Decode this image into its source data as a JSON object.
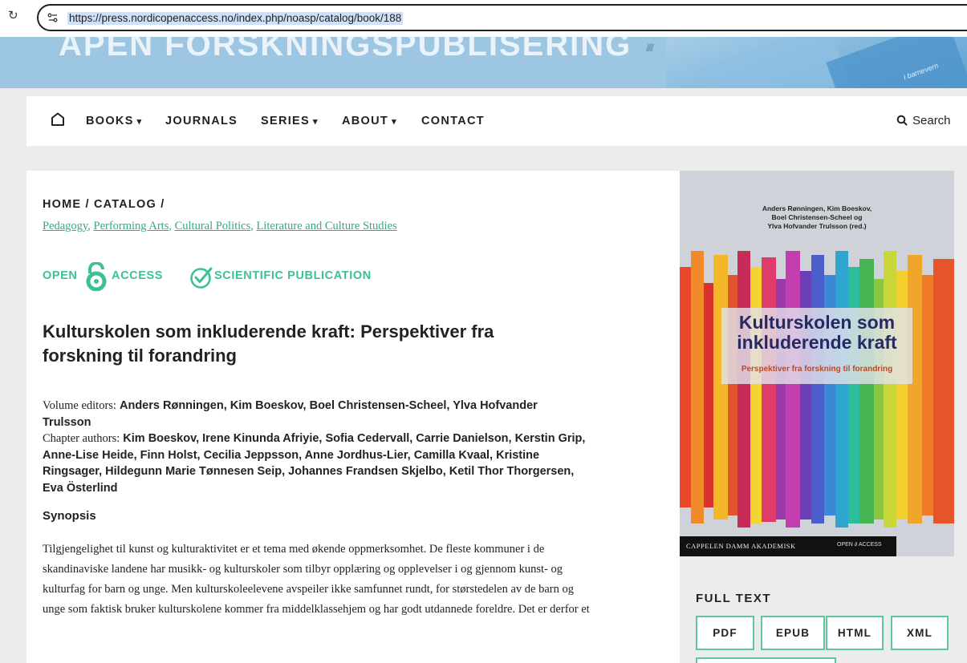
{
  "browser": {
    "url": "https://press.nordicopenaccess.no/index.php/noasp/catalog/book/188"
  },
  "banner": {
    "title": "ÅPEN FORSKNINGSPUBLISERING",
    "small_text": "i barnevern"
  },
  "nav": {
    "items": [
      {
        "label": "BOOKS",
        "caret": true
      },
      {
        "label": "JOURNALS",
        "caret": false
      },
      {
        "label": "SERIES",
        "caret": true
      },
      {
        "label": "ABOUT",
        "caret": true
      },
      {
        "label": "CONTACT",
        "caret": false
      }
    ],
    "search_label": "Search"
  },
  "breadcrumb": {
    "home": "HOME",
    "catalog": "CATALOG",
    "separator": "/"
  },
  "categories": [
    "Pedagogy",
    "Performing Arts",
    "Cultural Politics",
    "Literature and Culture Studies"
  ],
  "badges": {
    "open_left": "OPEN",
    "open_right": "ACCESS",
    "scientific": "SCIENTIFIC PUBLICATION",
    "color": "#3cc290"
  },
  "book": {
    "title": "Kulturskolen som inkluderende kraft: Perspektiver fra forskning til forandring",
    "editors_label": "Volume editors:",
    "editors": "Anders Rønningen, Kim Boeskov, Boel Christensen-Scheel, Ylva Hofvander Trulsson",
    "authors_label": "Chapter authors:",
    "authors": "Kim Boeskov, Irene Kinunda Afriyie, Sofia Cedervall, Carrie Danielson, Kerstin Grip, Anne-Lise Heide, Finn Holst, Cecilia Jeppsson, Anne Jordhus-Lier, Camilla Kvaal, Kristine Ringsager, Hildegunn Marie Tønnesen Seip, Johannes Frandsen Skjelbo, Ketil Thor Thorgersen, Eva Österlind",
    "synopsis_heading": "Synopsis",
    "synopsis": "Tilgjengelighet til kunst og kulturaktivitet er et tema med økende oppmerksomhet. De fleste kommuner i de skandinaviske landene har musikk- og kulturskoler som tilbyr opplæring og opplevelser i og gjennom kunst- og kulturfag for barn og unge. Men kulturskoleelevene avspeiler ikke samfunnet rundt, for størstedelen av de barn og unge som faktisk bruker kulturskolene kommer fra middelklassehjem og har godt utdannede foreldre. Det er derfor et"
  },
  "cover": {
    "authors_line1": "Anders Rønningen, Kim Boeskov,",
    "authors_line2": "Boel Christensen-Scheel og",
    "authors_line3": "Ylva Hofvander Trulsson (red.)",
    "title_line1": "Kulturskolen som",
    "title_line2": "inkluderende kraft",
    "subtitle": "Perspektiver fra forskning til forandring",
    "publisher": "CAPPELEN DAMM AKADEMISK",
    "oa_left": "OPEN",
    "oa_right": "ACCESS"
  },
  "fulltext": {
    "heading": "FULL TEXT",
    "buttons": [
      "PDF",
      "EPUB",
      "HTML",
      "XML"
    ],
    "accent": "#5fc79c"
  }
}
